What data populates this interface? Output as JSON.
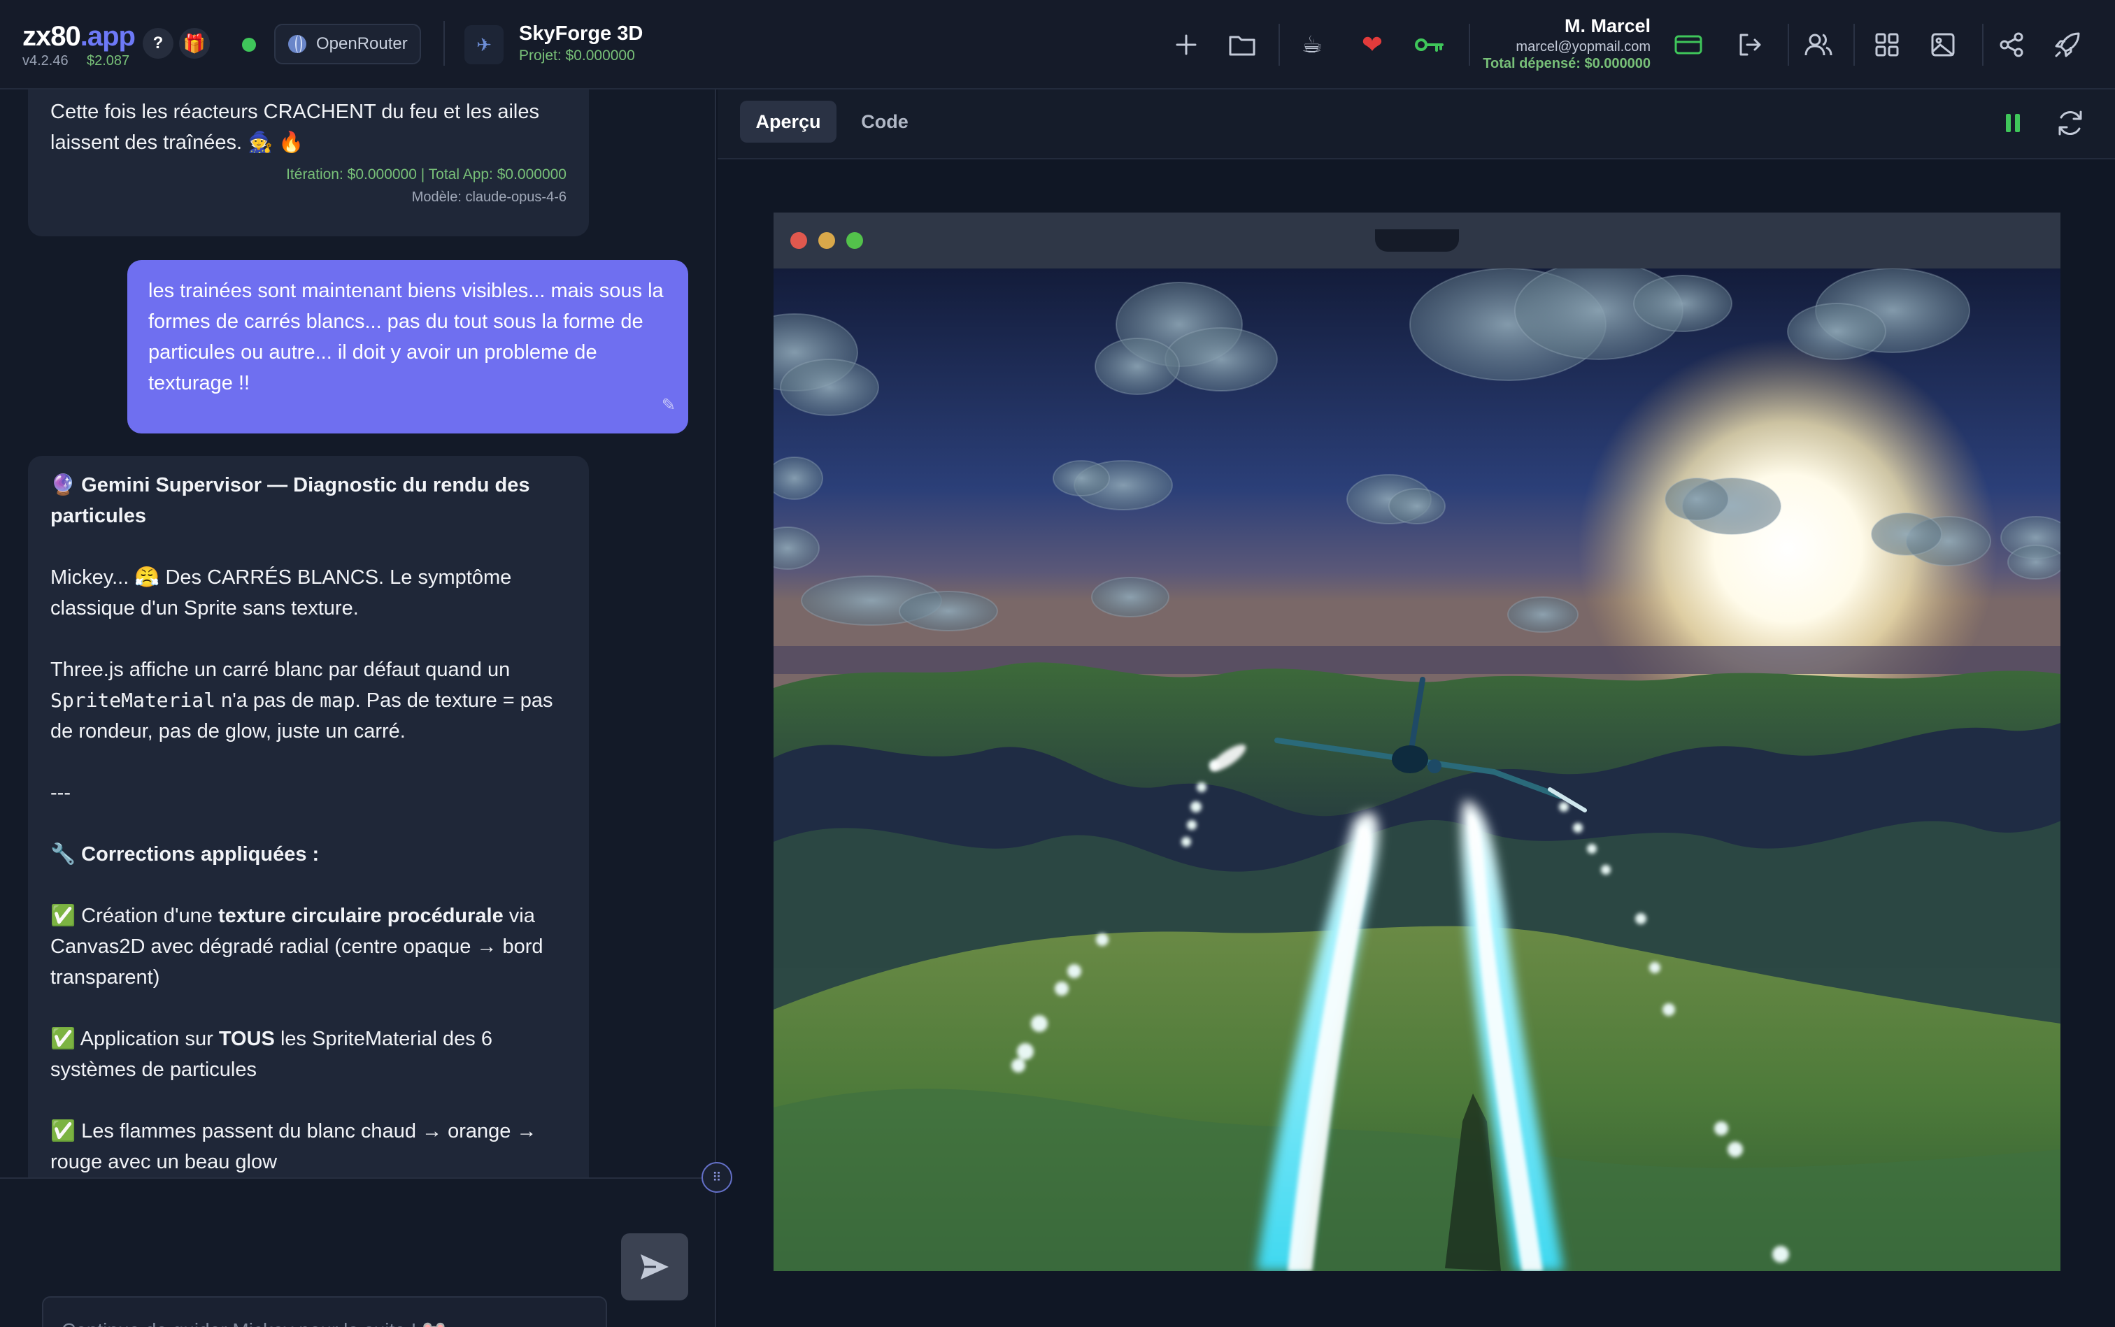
{
  "header": {
    "logo_main": "zx80",
    "logo_suffix": ".app",
    "version": "v4.2.46",
    "balance": "$2.087",
    "help_label": "?",
    "provider_label": "OpenRouter",
    "project_title": "SkyForge 3D",
    "project_cost": "Projet: $0.000000",
    "user_name": "M. Marcel",
    "user_email": "marcel@yopmail.com",
    "user_spent": "Total dépensé: $0.000000"
  },
  "colors": {
    "accent": "#6f6ff0",
    "success": "#3fc65a",
    "cost_green": "#78c078",
    "favorite": "#e23b3b",
    "panel_bg": "#131a28"
  },
  "icons": [
    "plus-icon",
    "folder-icon",
    "coffee-icon",
    "heart-icon",
    "key-icon",
    "card-icon",
    "logout-icon",
    "users-icon",
    "grid-icon",
    "image-icon",
    "share-icon",
    "rocket-icon"
  ],
  "chat": {
    "msg1": {
      "text": "Cette fois les réacteurs CRACHENT du feu et les ailes laissent des traînées. 🧙 🔥",
      "iteration_cost": "Itération: $0.000000 | Total App: $0.000000",
      "model": "Modèle: claude-opus-4-6"
    },
    "msg2": {
      "text": "les trainées sont maintenant biens visibles... mais sous la formes de carrés blancs... pas du tout sous la forme de particules ou autre... il doit y avoir un probleme de texturage !!"
    },
    "msg3": {
      "title": "🔮 Gemini Supervisor — Diagnostic du rendu des particules",
      "p1": "Mickey... 😤 Des CARRÉS BLANCS. Le symptôme classique d'un Sprite sans texture.",
      "p2_a": "Three.js affiche un carré blanc par défaut quand un ",
      "p2_code1": "SpriteMaterial",
      "p2_b": " n'a pas de ",
      "p2_code2": "map",
      "p2_c": ". Pas de texture = pas de rondeur, pas de glow, juste un carré.",
      "separator": "---",
      "corrections_title": "🔧 Corrections appliquées :",
      "c1_a": "✅ Création d'une ",
      "c1_b": "texture circulaire procédurale",
      "c1_c": " via Canvas2D avec dégradé radial (centre opaque → bord transparent)",
      "c2_a": "✅ Application sur ",
      "c2_b": "TOUS",
      "c2_c": " les SpriteMaterial des 6 systèmes de particules",
      "c3": "✅ Les flammes passent du blanc chaud → orange → rouge avec un beau glow"
    },
    "input_placeholder": "Continue de guider Mickey pour la suite ! 🐭"
  },
  "preview": {
    "tabs": [
      "Aperçu",
      "Code"
    ],
    "active_tab": "Aperçu"
  }
}
